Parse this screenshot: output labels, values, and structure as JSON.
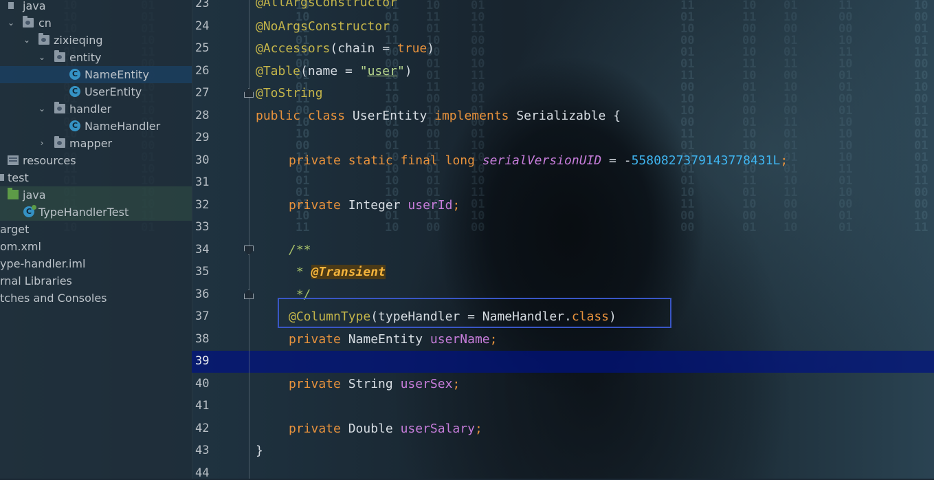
{
  "project_tree": {
    "items": [
      {
        "label": "java",
        "icon": "source-folder-icon"
      },
      {
        "label": "cn",
        "icon": "package-icon"
      },
      {
        "label": "zixieqing",
        "icon": "package-icon"
      },
      {
        "label": "entity",
        "icon": "package-icon"
      },
      {
        "label": "NameEntity",
        "icon": "class-icon",
        "icon_glyph": "C"
      },
      {
        "label": "UserEntity",
        "icon": "class-icon",
        "icon_glyph": "C"
      },
      {
        "label": "handler",
        "icon": "package-icon"
      },
      {
        "label": "NameHandler",
        "icon": "class-icon",
        "icon_glyph": "C"
      },
      {
        "label": "mapper",
        "icon": "package-icon"
      },
      {
        "label": "resources",
        "icon": "resources-folder-icon"
      },
      {
        "label": "test",
        "icon": "folder-icon"
      },
      {
        "label": "java",
        "icon": "test-source-folder-icon"
      },
      {
        "label": "TypeHandlerTest",
        "icon": "test-class-icon",
        "icon_glyph": "C"
      },
      {
        "label": "arget",
        "icon": "folder-icon"
      },
      {
        "label": "om.xml",
        "icon": "file-icon"
      },
      {
        "label": "ype-handler.iml",
        "icon": "file-icon"
      },
      {
        "label": "rnal Libraries",
        "icon": "library-icon"
      },
      {
        "label": "tches and Consoles",
        "icon": "console-icon"
      }
    ]
  },
  "editor": {
    "line_numbers": [
      "23",
      "24",
      "25",
      "26",
      "27",
      "28",
      "29",
      "30",
      "31",
      "32",
      "33",
      "34",
      "35",
      "36",
      "37",
      "38",
      "39",
      "40",
      "41",
      "42",
      "43",
      "44"
    ],
    "current_line": "39",
    "code": {
      "l23": {
        "ann": "@AllArgsConstructor"
      },
      "l24": {
        "ann": "@NoArgsConstructor"
      },
      "l25": {
        "ann": "@Accessors",
        "open": "(chain = ",
        "kw": "true",
        "close": ")"
      },
      "l26": {
        "ann": "@Table",
        "open": "(name = ",
        "q1": "\"",
        "str": "user",
        "q2": "\"",
        "close": ")"
      },
      "l27": {
        "ann": "@ToString"
      },
      "l28": {
        "kw1": "public",
        "kw2": "class",
        "name": "UserEntity",
        "kw3": "implements",
        "iface": "Serializable",
        "brace": "{"
      },
      "l30": {
        "kw1": "private",
        "kw2": "static",
        "kw3": "final",
        "kw4": "long",
        "field": "serialVersionUID",
        "eq": " = -",
        "num": "5580827379143778431L",
        "semi": ";"
      },
      "l32": {
        "kw": "private",
        "type": "Integer",
        "field": "userId",
        "semi": ";"
      },
      "l34": {
        "doc": "/**"
      },
      "l35": {
        "star": " * ",
        "tag": "@Transient"
      },
      "l36": {
        "doc": " */"
      },
      "l37": {
        "ann": "@ColumnType",
        "open": "(typeHandler = ",
        "cls": "NameHandler.",
        "kw": "class",
        "close": ")"
      },
      "l38": {
        "kw": "private",
        "type": "NameEntity",
        "field": "userName",
        "semi": ";"
      },
      "l40": {
        "kw": "private",
        "type": "String",
        "field": "userSex",
        "semi": ";"
      },
      "l42": {
        "kw": "private",
        "type": "Double",
        "field": "userSalary",
        "semi": ";"
      },
      "l43": {
        "brace": "}"
      }
    }
  },
  "colors": {
    "keyword": "#e8923c",
    "annotation": "#c4b54a",
    "string": "#b6d58c",
    "field": "#c77ddb",
    "number": "#3fb5f0",
    "selection_box": "#3956c6",
    "caret_row": "#00127f"
  }
}
